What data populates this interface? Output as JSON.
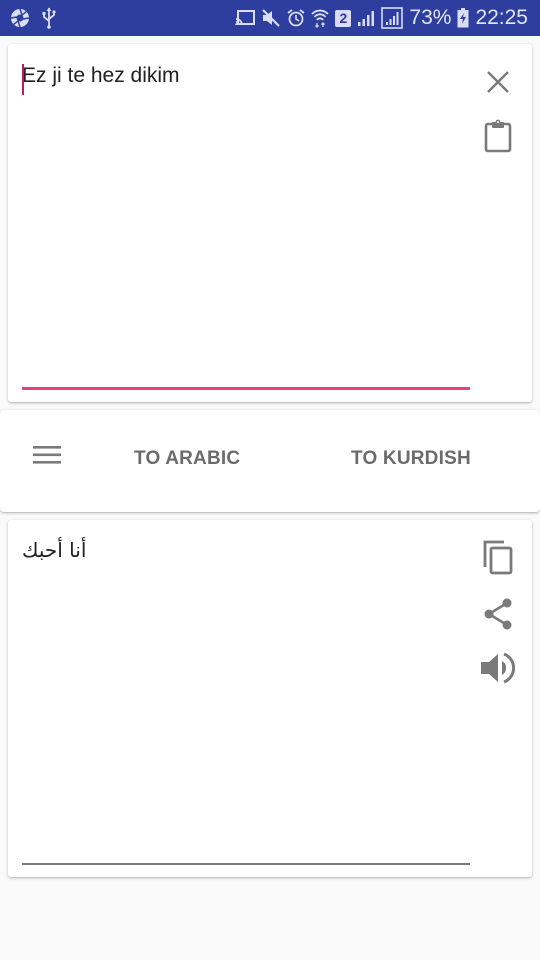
{
  "status_bar": {
    "left_icons": [
      "aperture-icon",
      "usb-icon"
    ],
    "right_icons": [
      "cast-icon",
      "mute-icon",
      "alarm-icon",
      "wifi-icon",
      "sim-2-badge",
      "signal-icon",
      "signal-boxed-icon",
      "battery-charging-icon"
    ],
    "sim_badge": "2",
    "battery": "73%",
    "time": "22:25",
    "background": "#2d3e9e"
  },
  "input_card": {
    "text": "Ez ji te hez dikim",
    "clear_icon": "close-icon",
    "paste_icon": "clipboard-icon",
    "accent_color": "#e0447d"
  },
  "actions": {
    "menu_icon": "menu-icon",
    "to_arabic": "TO ARABIC",
    "to_kurdish": "TO KURDISH"
  },
  "output_card": {
    "text": "أنا أحبك",
    "copy_icon": "copy-icon",
    "share_icon": "share-icon",
    "speak_icon": "volume-icon"
  }
}
